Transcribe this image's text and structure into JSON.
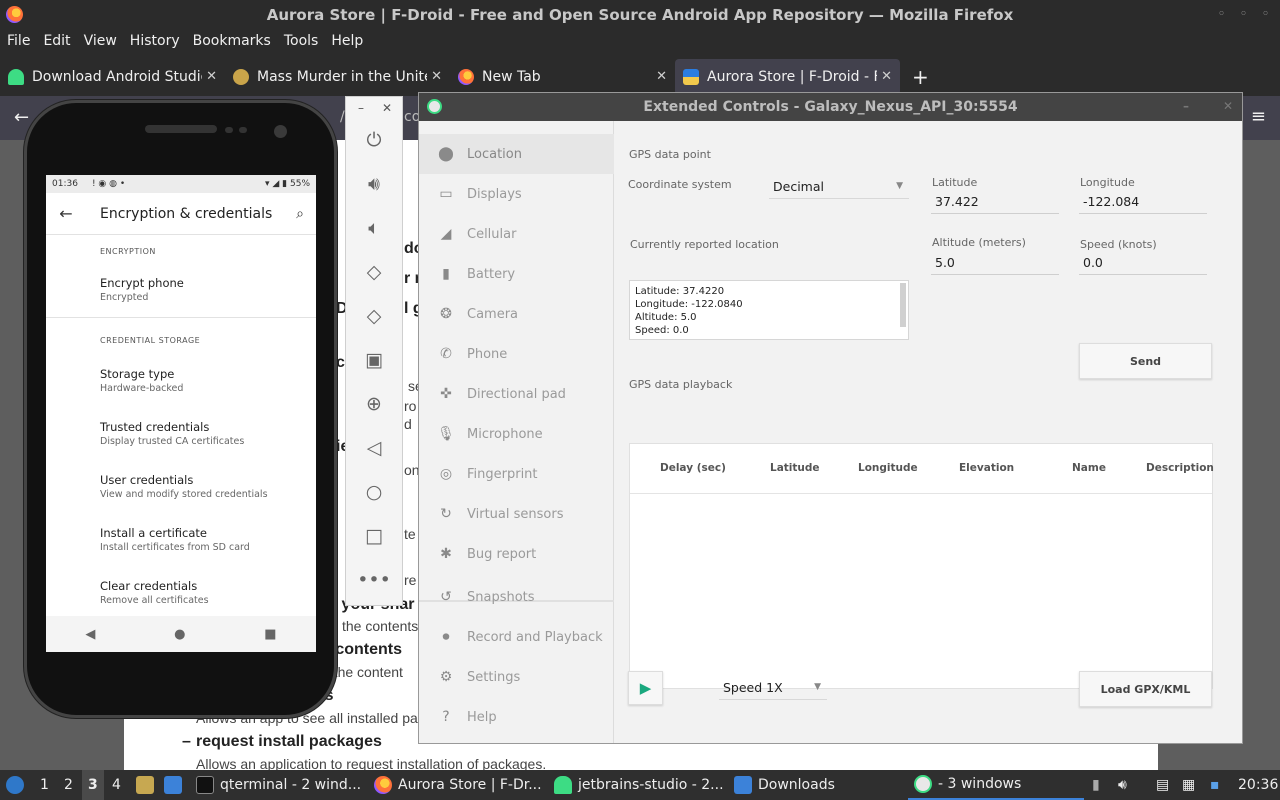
{
  "firefox": {
    "window_title": "Aurora Store | F-Droid - Free and Open Source Android App Repository — Mozilla Firefox",
    "menu": [
      "File",
      "Edit",
      "View",
      "History",
      "Bookmarks",
      "Tools",
      "Help"
    ],
    "tabs": [
      {
        "label": "Download Android Studio",
        "active": false
      },
      {
        "label": "Mass Murder in the United",
        "active": false
      },
      {
        "label": "New Tab",
        "active": false
      },
      {
        "label": "Aurora Store | F-Droid - Fr",
        "active": true
      }
    ],
    "url_fragment": "/pa",
    "url_fragment2": "co",
    "page": {
      "frag1": "do",
      "frag2": "r n",
      "frag3": "D",
      "frag4": "l g",
      "frag5": "c",
      "frag6": "se",
      "frag7": "ro",
      "frag8": "d",
      "frag9": "ie",
      "frag10": "on",
      "frag11": "te",
      "frag12": "re",
      "item_change_contents": "of your shar",
      "item_change_contents_sub": "the contents",
      "item_read_contents": "e contents",
      "item_read_contents_sub": "e the content",
      "item_packages": "ges",
      "item_packages_sub": "Allows an app to see all installed pa",
      "item_install": "request install packages",
      "item_install_sub": "Allows an application to request installation of packages."
    }
  },
  "phone": {
    "status_time": "01:36",
    "status_icons": "!  ◉  ◍  •",
    "status_right": "▾ ◢ ▮ 55%",
    "title": "Encryption & credentials",
    "sections": [
      {
        "header": "ENCRYPTION",
        "items": [
          {
            "title": "Encrypt phone",
            "summary": "Encrypted"
          }
        ]
      },
      {
        "header": "CREDENTIAL STORAGE",
        "items": [
          {
            "title": "Storage type",
            "summary": "Hardware-backed"
          },
          {
            "title": "Trusted credentials",
            "summary": "Display trusted CA certificates"
          },
          {
            "title": "User credentials",
            "summary": "View and modify stored credentials"
          },
          {
            "title": "Install a certificate",
            "summary": "Install certificates from SD card"
          },
          {
            "title": "Clear credentials",
            "summary": "Remove all certificates"
          }
        ]
      }
    ]
  },
  "extended_controls": {
    "title": "Extended Controls - Galaxy_Nexus_API_30:5554",
    "sidebar": [
      {
        "label": "Location",
        "icon": "location-pin-icon",
        "active": true
      },
      {
        "label": "Displays",
        "icon": "display-icon"
      },
      {
        "label": "Cellular",
        "icon": "cellular-signal-icon"
      },
      {
        "label": "Battery",
        "icon": "battery-icon"
      },
      {
        "label": "Camera",
        "icon": "camera-aperture-icon"
      },
      {
        "label": "Phone",
        "icon": "phone-icon"
      },
      {
        "label": "Directional pad",
        "icon": "dpad-icon"
      },
      {
        "label": "Microphone",
        "icon": "microphone-icon"
      },
      {
        "label": "Fingerprint",
        "icon": "fingerprint-icon"
      },
      {
        "label": "Virtual sensors",
        "icon": "sensors-icon"
      },
      {
        "label": "Bug report",
        "icon": "bug-icon"
      },
      {
        "label": "Snapshots",
        "icon": "snapshots-icon"
      },
      {
        "label": "Record and Playback",
        "icon": "record-icon"
      },
      {
        "label": "Settings",
        "icon": "gear-icon"
      },
      {
        "label": "Help",
        "icon": "help-icon"
      }
    ],
    "location": {
      "section_gps_point": "GPS data point",
      "coordinate_system_label": "Coordinate system",
      "coordinate_system_value": "Decimal",
      "latitude_label": "Latitude",
      "latitude_value": "37.422",
      "longitude_label": "Longitude",
      "longitude_value": "-122.084",
      "reported_label": "Currently reported location",
      "reported_lines": [
        "Latitude: 37.4220",
        "Longitude: -122.0840",
        "Altitude: 5.0",
        "Speed: 0.0"
      ],
      "altitude_label": "Altitude (meters)",
      "altitude_value": "5.0",
      "speed_label": "Speed (knots)",
      "speed_value": "0.0",
      "send_label": "Send",
      "section_playback": "GPS data playback",
      "table_columns": [
        "Delay (sec)",
        "Latitude",
        "Longitude",
        "Elevation",
        "Name",
        "Description"
      ],
      "speed_select": "Speed 1X",
      "load_label": "Load GPX/KML"
    }
  },
  "taskbar": {
    "workspaces": [
      "1",
      "2",
      "3",
      "4"
    ],
    "items": [
      {
        "label": "qterminal - 2 wind..."
      },
      {
        "label": "Aurora Store | F-Dr..."
      },
      {
        "label": "jetbrains-studio - 2..."
      },
      {
        "label": "Downloads"
      },
      {
        "label": "- 3 windows"
      }
    ],
    "clock": "20:36"
  },
  "colors": {
    "firefox_dark": "#2b2b2b",
    "firefox_tab_active": "#42414d",
    "play_green": "#1aa87e",
    "android_green": "#3ddc84"
  }
}
